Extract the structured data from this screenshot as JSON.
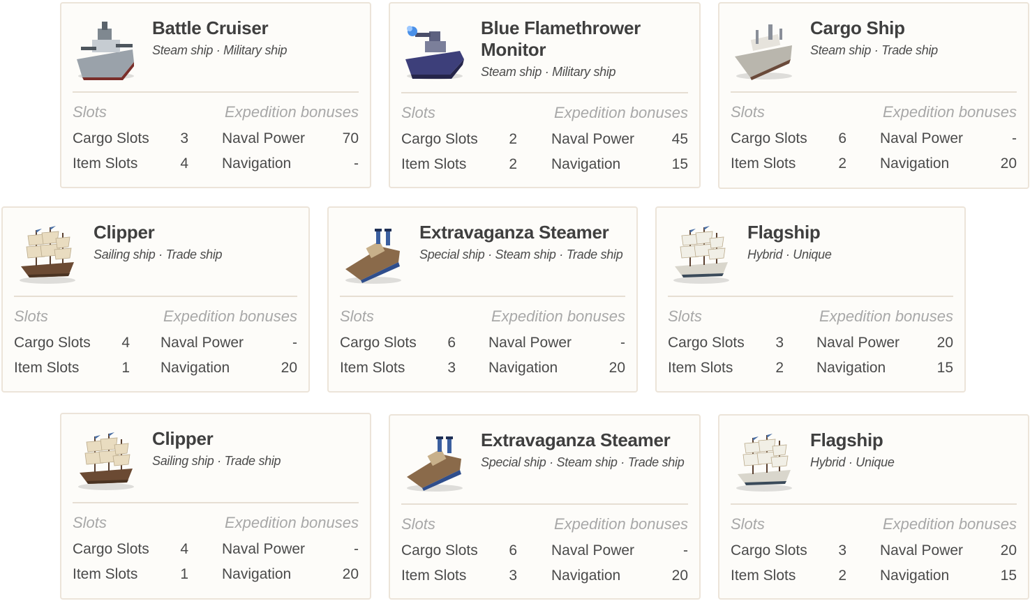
{
  "labels": {
    "slots": "Slots",
    "expedition": "Expedition bonuses",
    "cargo_slots": "Cargo Slots",
    "item_slots": "Item Slots",
    "naval_power": "Naval Power",
    "navigation": "Navigation"
  },
  "colors": {
    "card_bg": "#fdfcf9",
    "card_border": "#ece4d9",
    "heading_muted": "#a8a8a8",
    "text": "#444444"
  },
  "ships": [
    {
      "name": "Battle Cruiser",
      "subtitle": "Steam ship · Military ship",
      "cargo": "3",
      "item": "4",
      "naval": "70",
      "navigation": "-",
      "icon": "battle-cruiser-icon"
    },
    {
      "name": "Blue Flamethrower Monitor",
      "subtitle": "Steam ship · Military ship",
      "cargo": "2",
      "item": "2",
      "naval": "45",
      "navigation": "15",
      "icon": "flamethrower-monitor-icon"
    },
    {
      "name": "Cargo Ship",
      "subtitle": "Steam ship · Trade ship",
      "cargo": "6",
      "item": "2",
      "naval": "-",
      "navigation": "20",
      "icon": "cargo-ship-icon"
    },
    {
      "name": "Clipper",
      "subtitle": "Sailing ship · Trade ship",
      "cargo": "4",
      "item": "1",
      "naval": "-",
      "navigation": "20",
      "icon": "clipper-icon"
    },
    {
      "name": "Extravaganza Steamer",
      "subtitle": "Special ship · Steam ship · Trade ship",
      "cargo": "6",
      "item": "3",
      "naval": "-",
      "navigation": "20",
      "icon": "extravaganza-steamer-icon"
    },
    {
      "name": "Flagship",
      "subtitle": "Hybrid · Unique",
      "cargo": "3",
      "item": "2",
      "naval": "20",
      "navigation": "15",
      "icon": "flagship-icon"
    },
    {
      "name": "Clipper",
      "subtitle": "Sailing ship · Trade ship",
      "cargo": "4",
      "item": "1",
      "naval": "-",
      "navigation": "20",
      "icon": "clipper-icon"
    },
    {
      "name": "Extravaganza Steamer",
      "subtitle": "Special ship · Steam ship · Trade ship",
      "cargo": "6",
      "item": "3",
      "naval": "-",
      "navigation": "20",
      "icon": "extravaganza-steamer-icon"
    },
    {
      "name": "Flagship",
      "subtitle": "Hybrid · Unique",
      "cargo": "3",
      "item": "2",
      "naval": "20",
      "navigation": "15",
      "icon": "flagship-icon"
    }
  ]
}
